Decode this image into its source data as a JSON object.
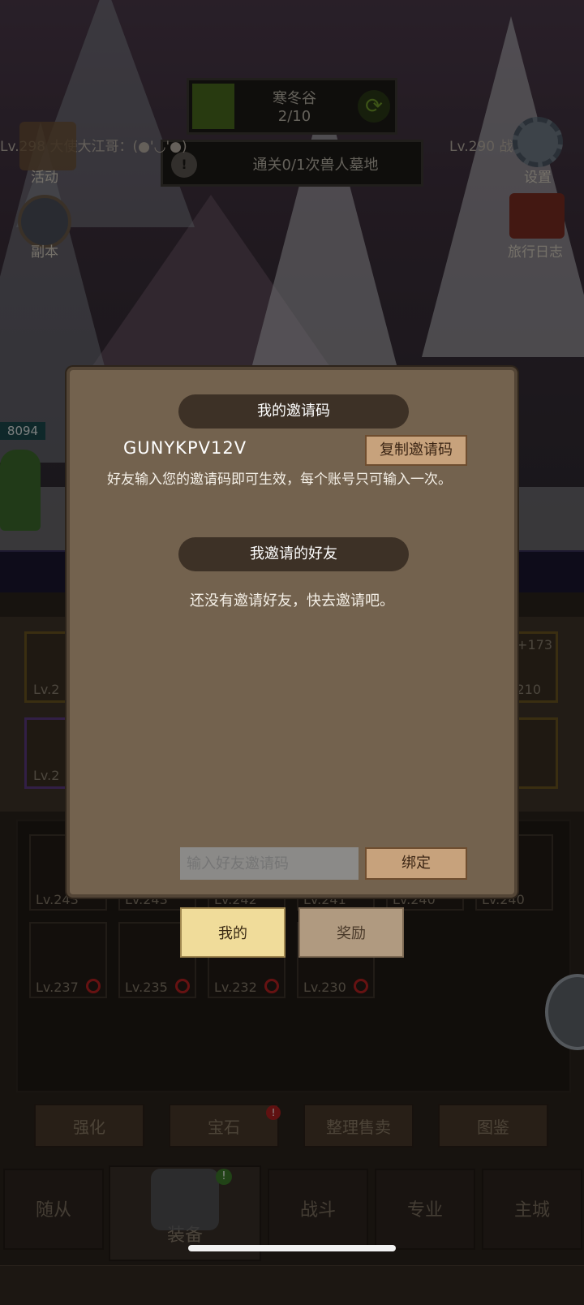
{
  "hud": {
    "stage_name": "寒冬谷",
    "stage_progress": "2/10",
    "stage_progress_fraction": 0.2,
    "quest_text": "通关0/1次兽人墓地",
    "left_player": "Lv.298 大使大江哥：(●'◡'●)",
    "right_player": "Lv.290 战士：o(*",
    "left_icons": [
      "活动",
      "副本"
    ],
    "right_icons": [
      "设置",
      "旅行日志"
    ],
    "side_number": "8094"
  },
  "equip": {
    "slot_levels_left": [
      "Lv.2",
      "Lv.2"
    ],
    "slot_right_top": "+173",
    "slot_right_level": "210",
    "inventory_row1": [
      "Lv.243",
      "Lv.243",
      "Lv.242",
      "Lv.241",
      "Lv.240",
      "Lv.240"
    ],
    "inventory_row2": [
      "Lv.237",
      "Lv.235",
      "Lv.232",
      "Lv.230"
    ]
  },
  "actions": [
    "强化",
    "宝石",
    "整理售卖",
    "图鉴"
  ],
  "tabs": [
    "随从",
    "装备",
    "战斗",
    "专业",
    "主城"
  ],
  "dialog": {
    "my_code_header": "我的邀请码",
    "code": "GUNYKPV12V",
    "copy_button": "复制邀请码",
    "description": "好友输入您的邀请码即可生效，每个账号只可输入一次。",
    "friends_header": "我邀请的好友",
    "no_friends_text": "还没有邀请好友，快去邀请吧。",
    "input_placeholder": "输入好友邀请码",
    "bind_button": "绑定"
  },
  "popup_tabs": {
    "mine": "我的",
    "reward": "奖励"
  }
}
